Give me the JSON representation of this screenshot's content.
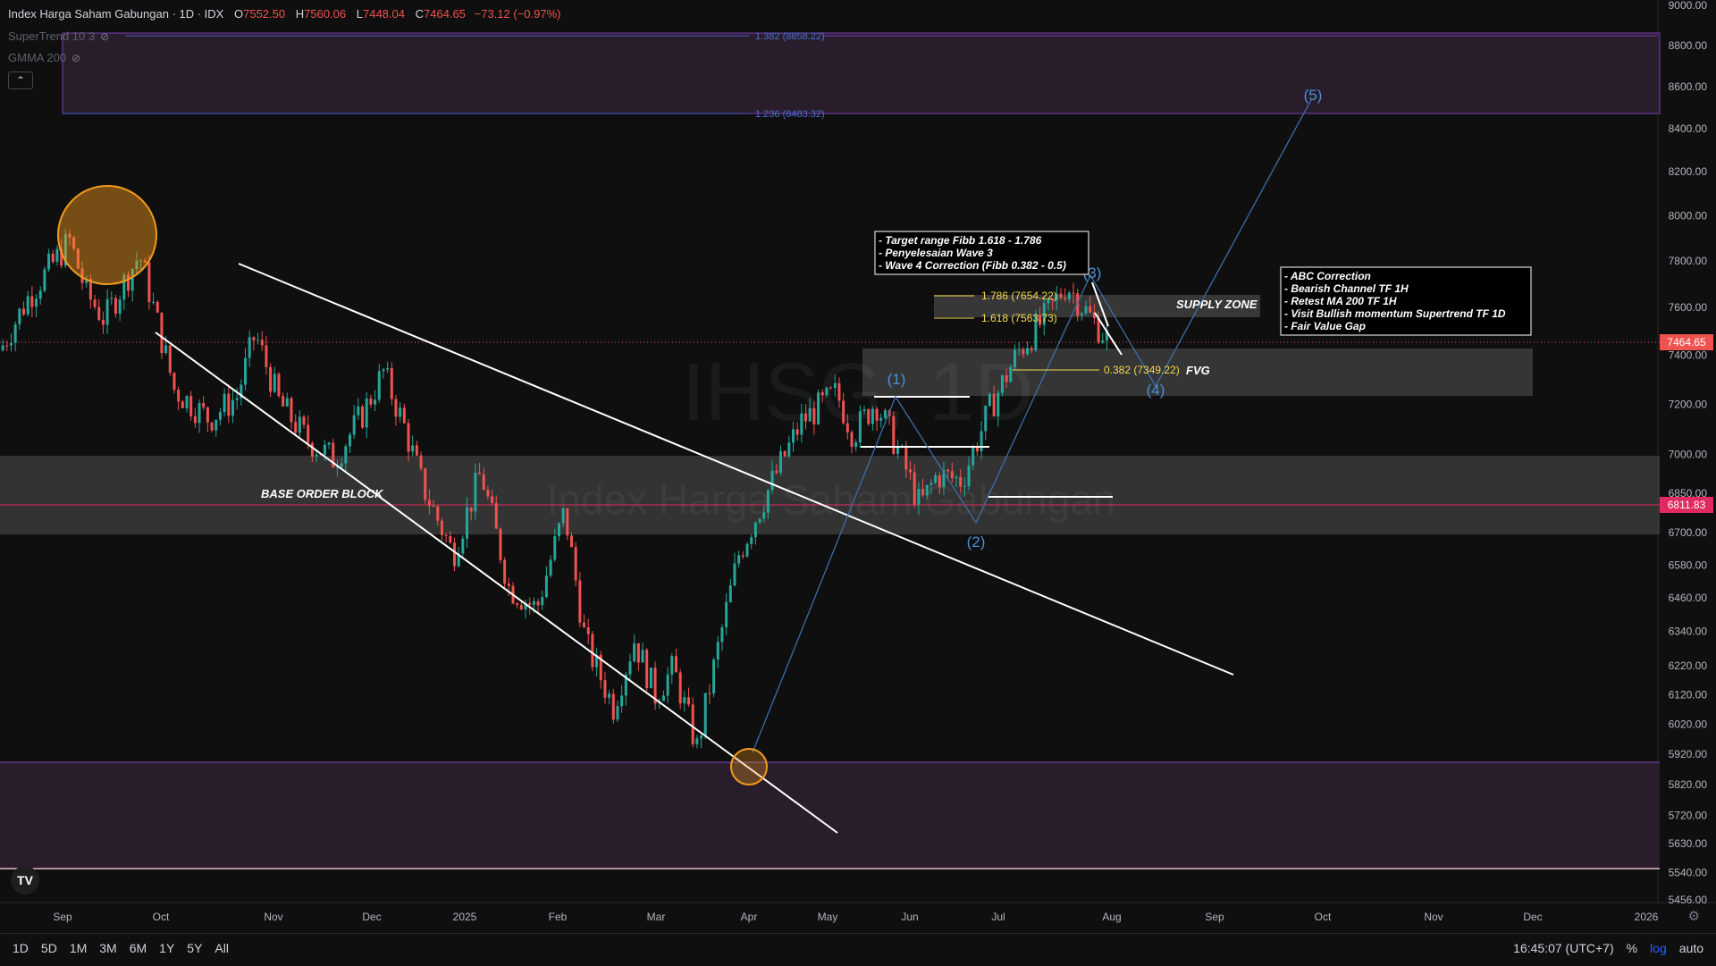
{
  "header": {
    "title": "Index Harga Saham Gabungan · 1D · IDX",
    "open_label": "O",
    "open": "7552.50",
    "high_label": "H",
    "high": "7560.06",
    "low_label": "L",
    "low": "7448.04",
    "close_label": "C",
    "close": "7464.65",
    "change": "−73.12 (−0.97%)"
  },
  "indicators": [
    {
      "label": "SuperTrend 10 3"
    },
    {
      "label": "GMMA 200"
    }
  ],
  "watermark": {
    "symbol": "IHSG, 1D",
    "name": "Index Harga Saham Gabungan"
  },
  "price_tags": {
    "last": "7464.65",
    "level": "6811.83"
  },
  "range_buttons": [
    "1D",
    "5D",
    "1M",
    "3M",
    "6M",
    "1Y",
    "5Y",
    "All"
  ],
  "bottom_right": {
    "time": "16:45:07 (UTC+7)",
    "percent": "%",
    "log": "log",
    "auto": "auto"
  },
  "colors": {
    "up": "#26a69a",
    "down": "#ef5350",
    "bg": "#0f0f0f",
    "fib": "#f5d94f",
    "wave": "#4a8fd6",
    "circle": "#f29a1c"
  },
  "chart_data": {
    "type": "candlestick",
    "scale": "log",
    "ylim": [
      5456,
      9000
    ],
    "y_ticks": [
      5456,
      5540,
      5630,
      5720,
      5820,
      5920,
      6020,
      6120,
      6220,
      6340,
      6460,
      6580,
      6700,
      6850,
      7000,
      7200,
      7400,
      7600,
      7800,
      8000,
      8200,
      8400,
      8600,
      8800,
      9000
    ],
    "x_labels": [
      "Sep",
      "Oct",
      "Nov",
      "Dec",
      "2025",
      "Feb",
      "Mar",
      "Apr",
      "May",
      "Jun",
      "Jul",
      "Aug",
      "Sep",
      "Oct",
      "Nov",
      "Dec",
      "2026"
    ],
    "pivots": [
      [
        0,
        7420
      ],
      [
        20,
        7640
      ],
      [
        50,
        7890
      ],
      [
        62,
        7660
      ],
      [
        75,
        7550
      ],
      [
        100,
        7830
      ],
      [
        125,
        7260
      ],
      [
        150,
        7140
      ],
      [
        170,
        7230
      ],
      [
        183,
        7490
      ],
      [
        200,
        7210
      ],
      [
        220,
        7060
      ],
      [
        240,
        6980
      ],
      [
        260,
        7160
      ],
      [
        275,
        7330
      ],
      [
        290,
        7110
      ],
      [
        303,
        6880
      ],
      [
        325,
        6620
      ],
      [
        345,
        6930
      ],
      [
        365,
        6500
      ],
      [
        385,
        6420
      ],
      [
        405,
        6780
      ],
      [
        420,
        6300
      ],
      [
        440,
        6080
      ],
      [
        455,
        6310
      ],
      [
        470,
        6120
      ],
      [
        483,
        6210
      ],
      [
        500,
        5940
      ],
      [
        530,
        6620
      ],
      [
        550,
        6850
      ],
      [
        575,
        7130
      ],
      [
        600,
        7245
      ],
      [
        612,
        7080
      ],
      [
        628,
        7210
      ],
      [
        645,
        7010
      ],
      [
        660,
        6800
      ],
      [
        672,
        6920
      ],
      [
        690,
        6900
      ],
      [
        710,
        7180
      ],
      [
        730,
        7410
      ],
      [
        750,
        7560
      ],
      [
        765,
        7700
      ],
      [
        782,
        7560
      ],
      [
        795,
        7465
      ]
    ],
    "annotations": {
      "fib_levels": [
        {
          "label": "1.786 (7654.22)",
          "value": 7654.22
        },
        {
          "label": "1.618 (7563.73)",
          "value": 7563.73
        },
        {
          "label": "0.382 (7349.22)",
          "value": 7349.22
        },
        {
          "label": "1.382 (8858.22)",
          "value": 8858.22
        },
        {
          "label": "1.236 (8483.32)",
          "value": 8483.32
        }
      ],
      "wave_labels": [
        "(1)",
        "(2)",
        "(3)",
        "(4)",
        "(5)"
      ],
      "zones": [
        "SUPPLY ZONE",
        "FVG",
        "BASE ORDER BLOCK"
      ],
      "note_left": [
        "- Target range Fibb 1.618 - 1.786",
        "- Penyelesaian Wave 3",
        "- Wave 4 Correction (Fibb 0.382 - 0.5)"
      ],
      "note_right": [
        "- ABC Correction",
        "- Bearish Channel TF 1H",
        "- Retest MA 200 TF 1H",
        "- Visit Bullish momentum Supertrend TF 1D",
        "- Fair Value Gap"
      ]
    }
  }
}
